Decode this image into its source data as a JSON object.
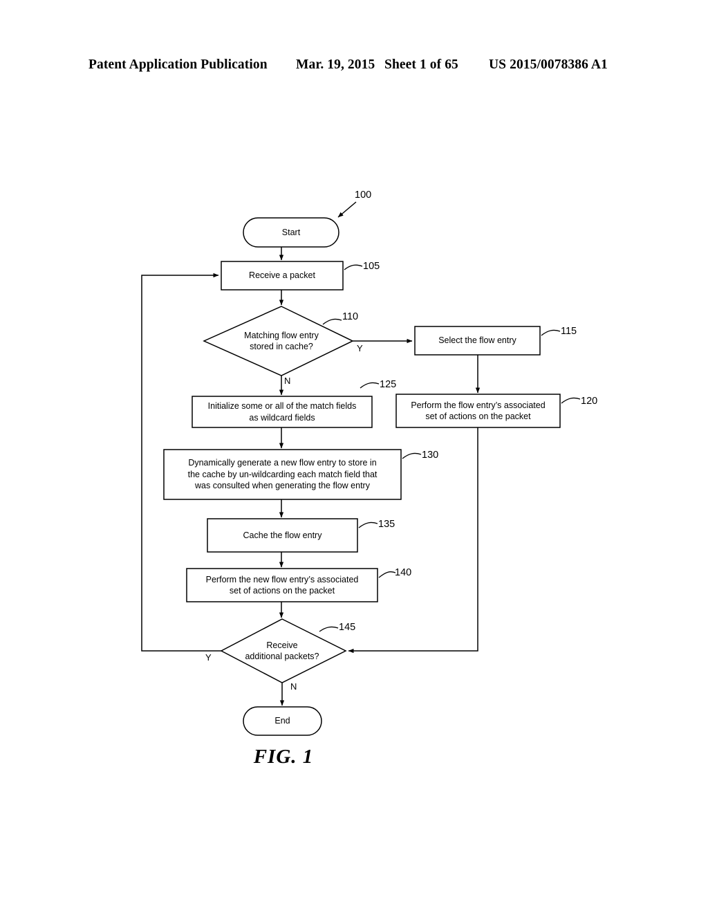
{
  "header": {
    "publication": "Patent Application Publication",
    "date": "Mar. 19, 2015",
    "sheet": "Sheet 1 of 65",
    "patent_number": "US 2015/0078386 A1"
  },
  "figure": {
    "caption": "FIG. 1",
    "diagram_reference": "100"
  },
  "nodes": {
    "start": {
      "label": "Start",
      "shape": "terminator"
    },
    "receive_packet": {
      "label": "Receive a packet",
      "ref": "105",
      "shape": "process"
    },
    "match_decision": {
      "label": "Matching flow entry\nstored in cache?",
      "ref": "110",
      "shape": "decision"
    },
    "select_entry": {
      "label": "Select the flow entry",
      "ref": "115",
      "shape": "process"
    },
    "perform_actions": {
      "label": "Perform the flow entry’s associated\nset of actions on the packet",
      "ref": "120",
      "shape": "process"
    },
    "init_wildcard": {
      "label": "Initialize some or all of the match fields\nas wildcard fields",
      "ref": "125",
      "shape": "process"
    },
    "generate_entry": {
      "label": "Dynamically generate a new flow entry to store in\nthe cache by un-wildcarding each match field that\nwas consulted when generating the flow entry",
      "ref": "130",
      "shape": "process"
    },
    "cache_entry": {
      "label": "Cache the flow entry",
      "ref": "135",
      "shape": "process"
    },
    "perform_new_actions": {
      "label": "Perform the new flow entry’s associated\nset of actions on the packet",
      "ref": "140",
      "shape": "process"
    },
    "more_packets": {
      "label": "Receive\nadditional packets?",
      "ref": "145",
      "shape": "decision"
    },
    "end": {
      "label": "End",
      "shape": "terminator"
    }
  },
  "branches": {
    "match_yes": "Y",
    "match_no": "N",
    "more_yes": "Y",
    "more_no": "N"
  },
  "colors": {
    "stroke": "#000000",
    "background": "#ffffff"
  }
}
